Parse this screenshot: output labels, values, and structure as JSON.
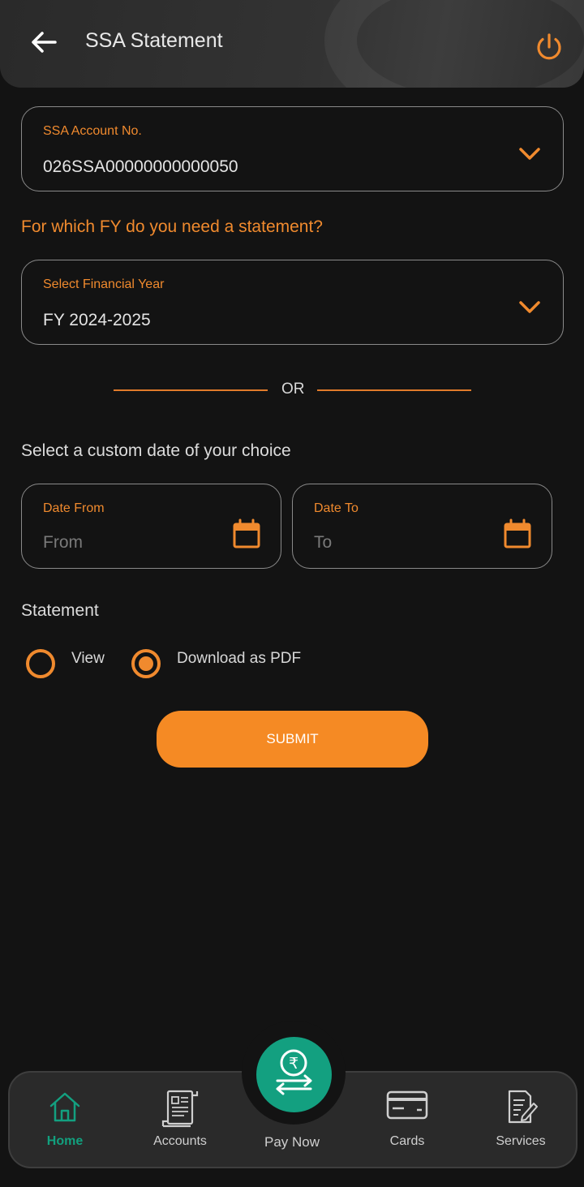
{
  "header": {
    "title": "SSA Statement",
    "back_icon": "arrow-left-icon",
    "power_icon": "power-icon"
  },
  "account": {
    "label": "SSA Account No.",
    "value": "026SSA00000000000050"
  },
  "question": "For which FY do you need a statement?",
  "financial_year": {
    "label": "Select Financial Year",
    "value": "FY 2024-2025"
  },
  "or_text": "OR",
  "custom_date": {
    "heading": "Select a custom date of your choice",
    "from": {
      "label": "Date From",
      "placeholder": "From"
    },
    "to": {
      "label": "Date To",
      "placeholder": "To"
    }
  },
  "statement": {
    "heading": "Statement",
    "options": [
      {
        "label": "View",
        "selected": false
      },
      {
        "label": "Download as PDF",
        "selected": true
      }
    ]
  },
  "submit_label": "SUBMIT",
  "bottom_nav": {
    "items": [
      {
        "label": "Home",
        "icon": "home-icon",
        "active": true
      },
      {
        "label": "Accounts",
        "icon": "accounts-icon",
        "active": false
      },
      {
        "label": "Pay Now",
        "icon": "rupee-transfer-icon",
        "active": false
      },
      {
        "label": "Cards",
        "icon": "card-icon",
        "active": false
      },
      {
        "label": "Services",
        "icon": "services-icon",
        "active": false
      }
    ]
  },
  "colors": {
    "accent": "#f08a2e",
    "button": "#f58a24",
    "nav_active": "#13a080",
    "background": "#131313"
  }
}
